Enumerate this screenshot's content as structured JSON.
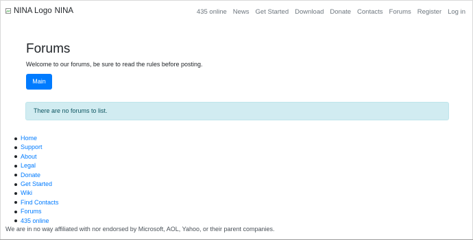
{
  "navbar": {
    "brand_alt": "NINA Logo",
    "brand_name": "NINA",
    "links": [
      "435 online",
      "News",
      "Get Started",
      "Download",
      "Donate",
      "Contacts",
      "Forums",
      "Register",
      "Log in"
    ]
  },
  "hero": {
    "title": "Forums",
    "lead": "Welcome to our forums, be sure to read the rules before posting.",
    "button_label": "Main"
  },
  "alert": {
    "text": "There are no forums to list."
  },
  "footer": {
    "links": [
      "Home",
      "Support",
      "About",
      "Legal",
      "Donate",
      "Get Started",
      "Wiki",
      "Find Contacts",
      "Forums",
      "435 online"
    ],
    "disclaimer": "We are in no way affiliated with nor endorsed by Microsoft, AOL, Yahoo, or their parent companies."
  },
  "colors": {
    "primary": "#007bff",
    "alert_bg": "#d1ecf1",
    "alert_text": "#0c5460",
    "nav_text": "#6c757d"
  }
}
